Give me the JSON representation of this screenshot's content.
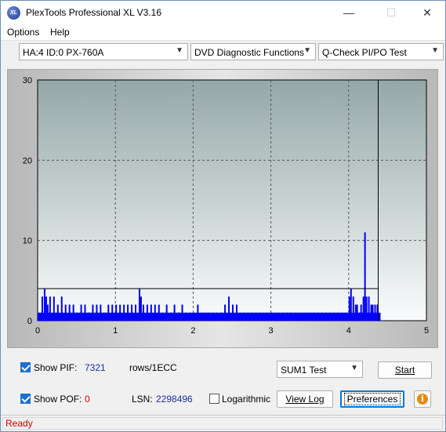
{
  "window": {
    "title": "PlexTools Professional XL V3.16",
    "icon_text": "XL",
    "controls": {
      "minimize": "—",
      "maximize": "☐",
      "close": "✕"
    }
  },
  "menu": {
    "options": "Options",
    "help": "Help"
  },
  "toolbar": {
    "drive": "HA:4 ID:0  PX-760A",
    "function": "DVD Diagnostic Functions",
    "test": "Q-Check PI/PO Test"
  },
  "chart_data": {
    "type": "bar",
    "x_ticks": [
      "0",
      "1",
      "2",
      "3",
      "4",
      "5"
    ],
    "y_ticks": [
      "0",
      "10",
      "20",
      "30"
    ],
    "xlim": [
      0,
      5
    ],
    "ylim": [
      0,
      30
    ],
    "grid": true,
    "threshold_line": 4,
    "end_marker_x": 4.38,
    "series_color": "#0000ff",
    "bars": [
      [
        0.0,
        1
      ],
      [
        0.05,
        3
      ],
      [
        0.08,
        4
      ],
      [
        0.1,
        3
      ],
      [
        0.12,
        2
      ],
      [
        0.15,
        3
      ],
      [
        0.2,
        3
      ],
      [
        0.25,
        2
      ],
      [
        0.3,
        3
      ],
      [
        0.35,
        2
      ],
      [
        0.4,
        2
      ],
      [
        0.45,
        2
      ],
      [
        0.5,
        1
      ],
      [
        0.55,
        2
      ],
      [
        0.6,
        2
      ],
      [
        0.65,
        1
      ],
      [
        0.7,
        2
      ],
      [
        0.75,
        2
      ],
      [
        0.8,
        2
      ],
      [
        0.85,
        1
      ],
      [
        0.9,
        2
      ],
      [
        0.95,
        2
      ],
      [
        1.0,
        2
      ],
      [
        1.05,
        2
      ],
      [
        1.1,
        2
      ],
      [
        1.15,
        2
      ],
      [
        1.2,
        2
      ],
      [
        1.25,
        2
      ],
      [
        1.3,
        4
      ],
      [
        1.32,
        3
      ],
      [
        1.35,
        2
      ],
      [
        1.4,
        2
      ],
      [
        1.45,
        2
      ],
      [
        1.5,
        2
      ],
      [
        1.55,
        2
      ],
      [
        1.6,
        1
      ],
      [
        1.65,
        2
      ],
      [
        1.7,
        1
      ],
      [
        1.75,
        2
      ],
      [
        1.8,
        1
      ],
      [
        1.85,
        2
      ],
      [
        1.9,
        1
      ],
      [
        1.95,
        1
      ],
      [
        2.0,
        1
      ],
      [
        2.05,
        2
      ],
      [
        2.1,
        1
      ],
      [
        2.15,
        1
      ],
      [
        2.2,
        1
      ],
      [
        2.25,
        1
      ],
      [
        2.3,
        1
      ],
      [
        2.35,
        1
      ],
      [
        2.4,
        2
      ],
      [
        2.45,
        3
      ],
      [
        2.5,
        2
      ],
      [
        2.55,
        2
      ],
      [
        2.6,
        1
      ],
      [
        2.65,
        1
      ],
      [
        2.7,
        1
      ],
      [
        2.75,
        1
      ],
      [
        2.8,
        1
      ],
      [
        2.85,
        1
      ],
      [
        2.9,
        1
      ],
      [
        2.95,
        1
      ],
      [
        3.0,
        1
      ],
      [
        3.05,
        1
      ],
      [
        3.1,
        1
      ],
      [
        3.15,
        1
      ],
      [
        3.2,
        1
      ],
      [
        3.25,
        1
      ],
      [
        3.3,
        1
      ],
      [
        3.35,
        1
      ],
      [
        3.4,
        1
      ],
      [
        3.45,
        1
      ],
      [
        3.5,
        1
      ],
      [
        3.55,
        1
      ],
      [
        3.6,
        1
      ],
      [
        3.65,
        1
      ],
      [
        3.7,
        1
      ],
      [
        3.75,
        1
      ],
      [
        3.8,
        1
      ],
      [
        3.85,
        1
      ],
      [
        3.9,
        1
      ],
      [
        3.95,
        1
      ],
      [
        4.0,
        3
      ],
      [
        4.02,
        4
      ],
      [
        4.05,
        3
      ],
      [
        4.08,
        2
      ],
      [
        4.1,
        2
      ],
      [
        4.13,
        1
      ],
      [
        4.15,
        2
      ],
      [
        4.18,
        3
      ],
      [
        4.2,
        11
      ],
      [
        4.22,
        3
      ],
      [
        4.25,
        3
      ],
      [
        4.28,
        2
      ],
      [
        4.3,
        2
      ],
      [
        4.33,
        2
      ],
      [
        4.36,
        2
      ]
    ]
  },
  "controls": {
    "show_pif_label": "Show PIF:",
    "pif_value": "7321",
    "pif_unit": "rows/1ECC",
    "show_pof_label": "Show POF:",
    "pof_value": "0",
    "lsn_label": "LSN:",
    "lsn_value": "2298496",
    "logarithmic_label": "Logarithmic",
    "sum_test": "SUM1 Test",
    "start": "Start",
    "view_log": "View Log",
    "preferences": "Preferences",
    "info_glyph": "i"
  },
  "status": {
    "text": "Ready"
  }
}
